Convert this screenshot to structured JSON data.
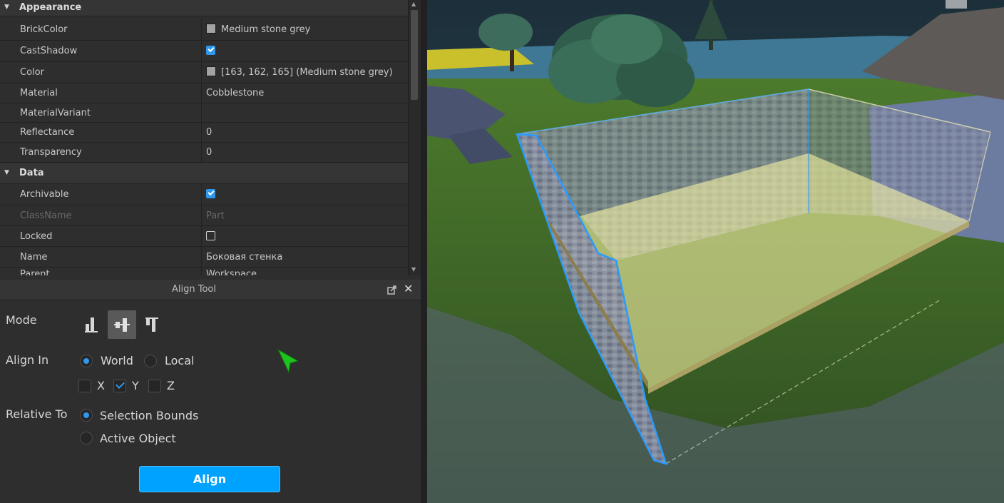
{
  "properties": {
    "sections": [
      {
        "label": "Appearance"
      },
      {
        "label": "Data"
      }
    ],
    "appearance_rows": [
      {
        "name": "BrickColor",
        "value": "Medium stone grey",
        "swatch": "#a3a2a5"
      },
      {
        "name": "CastShadow",
        "value": "",
        "checked": true
      },
      {
        "name": "Color",
        "value": "[163, 162, 165] (Medium stone grey)",
        "swatch": "#a3a2a5"
      },
      {
        "name": "Material",
        "value": "Cobblestone"
      },
      {
        "name": "MaterialVariant",
        "value": ""
      },
      {
        "name": "Reflectance",
        "value": "0"
      },
      {
        "name": "Transparency",
        "value": "0"
      }
    ],
    "data_rows": [
      {
        "name": "Archivable",
        "value": "",
        "checked": true
      },
      {
        "name": "ClassName",
        "value": "Part",
        "disabled": true
      },
      {
        "name": "Locked",
        "value": "",
        "checked": false
      },
      {
        "name": "Name",
        "value": "Боковая стенка"
      },
      {
        "name": "Parent",
        "value": "Workspace"
      }
    ]
  },
  "align_tool": {
    "title": "Align Tool",
    "mode_label": "Mode",
    "mode_selected": "center",
    "align_in_label": "Align In",
    "align_in_options": [
      "World",
      "Local"
    ],
    "align_in_selected": "World",
    "axes": [
      {
        "label": "X",
        "checked": false
      },
      {
        "label": "Y",
        "checked": true
      },
      {
        "label": "Z",
        "checked": false
      }
    ],
    "relative_to_label": "Relative To",
    "relative_to_options": [
      "Selection Bounds",
      "Active Object"
    ],
    "relative_to_selected": "Selection Bounds",
    "align_button": "Align"
  },
  "colors": {
    "accent": "#00a2ff",
    "check_blue": "#2f97ee",
    "selection_outline": "#2a9bff",
    "panel_bg": "#2e2e2e",
    "cursor": "#1ec21e"
  },
  "icons": [
    "collapse-triangle-icon",
    "dock-icon",
    "close-icon",
    "align-min-icon",
    "align-center-icon",
    "align-max-icon",
    "cursor-arrow-icon"
  ]
}
